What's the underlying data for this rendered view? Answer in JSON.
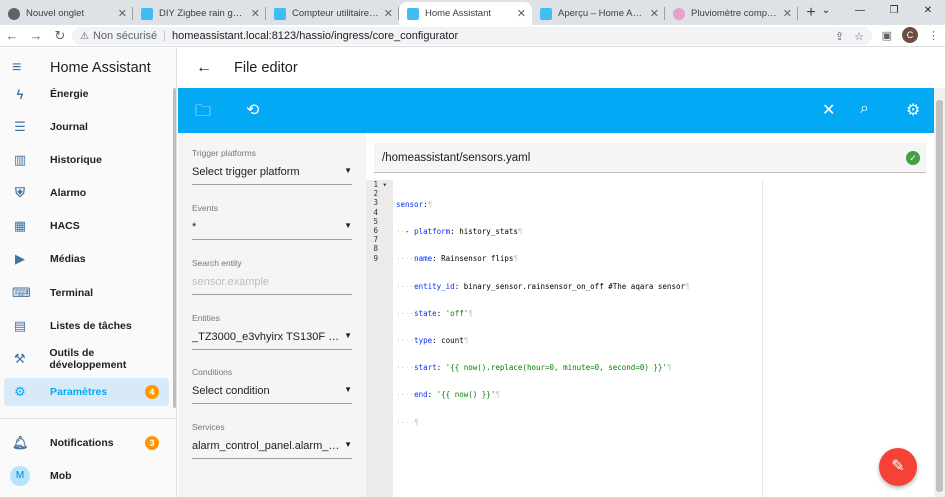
{
  "browser": {
    "tabs": [
      {
        "title": "Nouvel onglet",
        "icon": "globe-icon"
      },
      {
        "title": "DIY Zigbee rain gaug",
        "icon": "ha-icon"
      },
      {
        "title": "Compteur utilitaire - H",
        "icon": "ha-icon"
      },
      {
        "title": "Home Assistant",
        "icon": "ha-icon"
      },
      {
        "title": "Aperçu – Home Assista",
        "icon": "ha-icon"
      },
      {
        "title": "Pluviomètre compatib",
        "icon": "rain-icon"
      }
    ],
    "new_tab": "+",
    "security_label": "Non sécurisé",
    "url": "homeassistant.local:8123/hassio/ingress/core_configurator",
    "profile_initial": "C"
  },
  "sidebar": {
    "title": "Home Assistant",
    "items": [
      {
        "label": "Énergie",
        "icon": "lightning-icon"
      },
      {
        "label": "Journal",
        "icon": "list-icon"
      },
      {
        "label": "Historique",
        "icon": "chart-icon"
      },
      {
        "label": "Alarmo",
        "icon": "shield-icon"
      },
      {
        "label": "HACS",
        "icon": "hacs-icon"
      },
      {
        "label": "Médias",
        "icon": "play-icon"
      },
      {
        "label": "Terminal",
        "icon": "terminal-icon"
      },
      {
        "label": "Listes de tâches",
        "icon": "clipboard-icon"
      },
      {
        "label": "Outils de développement",
        "icon": "hammer-icon"
      },
      {
        "label": "Paramètres",
        "icon": "gear-icon",
        "badge": "4"
      }
    ],
    "notifications": {
      "label": "Notifications",
      "badge": "3"
    },
    "user": {
      "label": "Mob",
      "initial": "M"
    }
  },
  "header": {
    "title": "File editor"
  },
  "toolbar": {
    "accent": "#03a9f4"
  },
  "fields": [
    {
      "label": "Trigger platforms",
      "value": "Select trigger platform"
    },
    {
      "label": "Events",
      "value": "*"
    },
    {
      "label": "Search entity",
      "value": "sensor.example"
    },
    {
      "label": "Entities",
      "value": "_TZ3000_e3vhyirx TS130F Com..."
    },
    {
      "label": "Conditions",
      "value": "Select condition"
    },
    {
      "label": "Services",
      "value": "alarm_control_panel.alarm_arm_..."
    }
  ],
  "editor": {
    "filepath": "/homeassistant/sensors.yaml",
    "line_numbers": [
      "1",
      "2",
      "3",
      "4",
      "5",
      "6",
      "7",
      "8",
      "9"
    ],
    "lines": [
      {
        "indent": "",
        "key": "sensor",
        "rest": ""
      },
      {
        "indent": "··- ",
        "key": "platform",
        "rest": " history_stats"
      },
      {
        "indent": "····",
        "key": "name",
        "rest": " Rainsensor flips"
      },
      {
        "indent": "····",
        "key": "entity_id",
        "rest": " binary_sensor.rainsensor_on_off #The aqara sensor"
      },
      {
        "indent": "····",
        "key": "state",
        "rest": " 'off'"
      },
      {
        "indent": "····",
        "key": "type",
        "rest": " count"
      },
      {
        "indent": "····",
        "key": "start",
        "rest": " '{{ now().replace(hour=0, minute=0, second=0) }}'"
      },
      {
        "indent": "····",
        "key": "end",
        "rest": " '{{ now() }}'"
      },
      {
        "indent": "····",
        "key": "",
        "rest": "¶"
      }
    ]
  }
}
